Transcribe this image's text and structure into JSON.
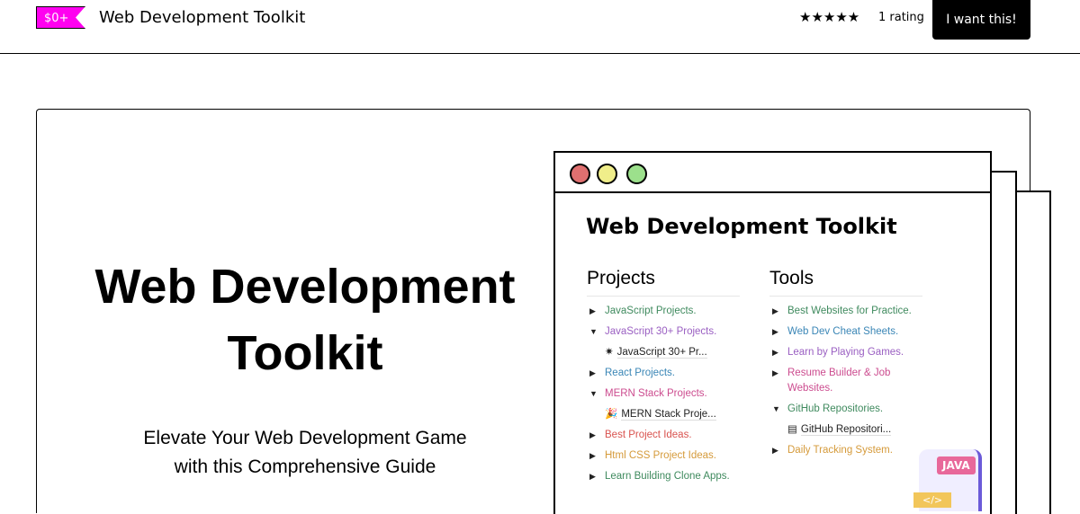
{
  "header": {
    "price_badge": "$0+",
    "title": "Web Development Toolkit",
    "stars": "★★★★★",
    "rating_text": "1 rating",
    "buy_label": "I want this!"
  },
  "hero": {
    "title_line1": "Web Development",
    "title_line2": "Toolkit",
    "subtitle_line1": "Elevate Your Web Development Game",
    "subtitle_line2": "with this Comprehensive Guide"
  },
  "preview": {
    "title": "Web Development Toolkit",
    "projects": {
      "heading": "Projects",
      "items": [
        {
          "label": "JavaScript Projects.",
          "color": "#3f8a5e"
        },
        {
          "label": "JavaScript 30+ Projects.",
          "color": "#9a5fc2",
          "sub": "JavaScript 30+ Pr..."
        },
        {
          "label": "React Projects.",
          "color": "#3a86b6"
        },
        {
          "label": "MERN Stack Projects.",
          "color": "#cc4c8f",
          "sub": "MERN Stack Proje..."
        },
        {
          "label": "Best Project Ideas.",
          "color": "#d9534f"
        },
        {
          "label": "Html CSS Project Ideas.",
          "color": "#d59a3a"
        },
        {
          "label": "Learn Building Clone Apps.",
          "color": "#3f8a5e"
        }
      ]
    },
    "tools": {
      "heading": "Tools",
      "items": [
        {
          "label": "Best Websites for Practice.",
          "color": "#3f8a5e"
        },
        {
          "label": "Web Dev Cheat Sheets.",
          "color": "#3a86b6"
        },
        {
          "label": "Learn by Playing Games.",
          "color": "#9a5fc2"
        },
        {
          "label": "Resume Builder & Job Websites.",
          "color": "#cc4c8f"
        },
        {
          "label": "GitHub Repositories.",
          "color": "#3f8a5e",
          "sub": "GitHub Repositori..."
        },
        {
          "label": "Daily Tracking System.",
          "color": "#d59a3a"
        }
      ]
    },
    "java_tag": "JAVA",
    "code_tag": "</>"
  }
}
